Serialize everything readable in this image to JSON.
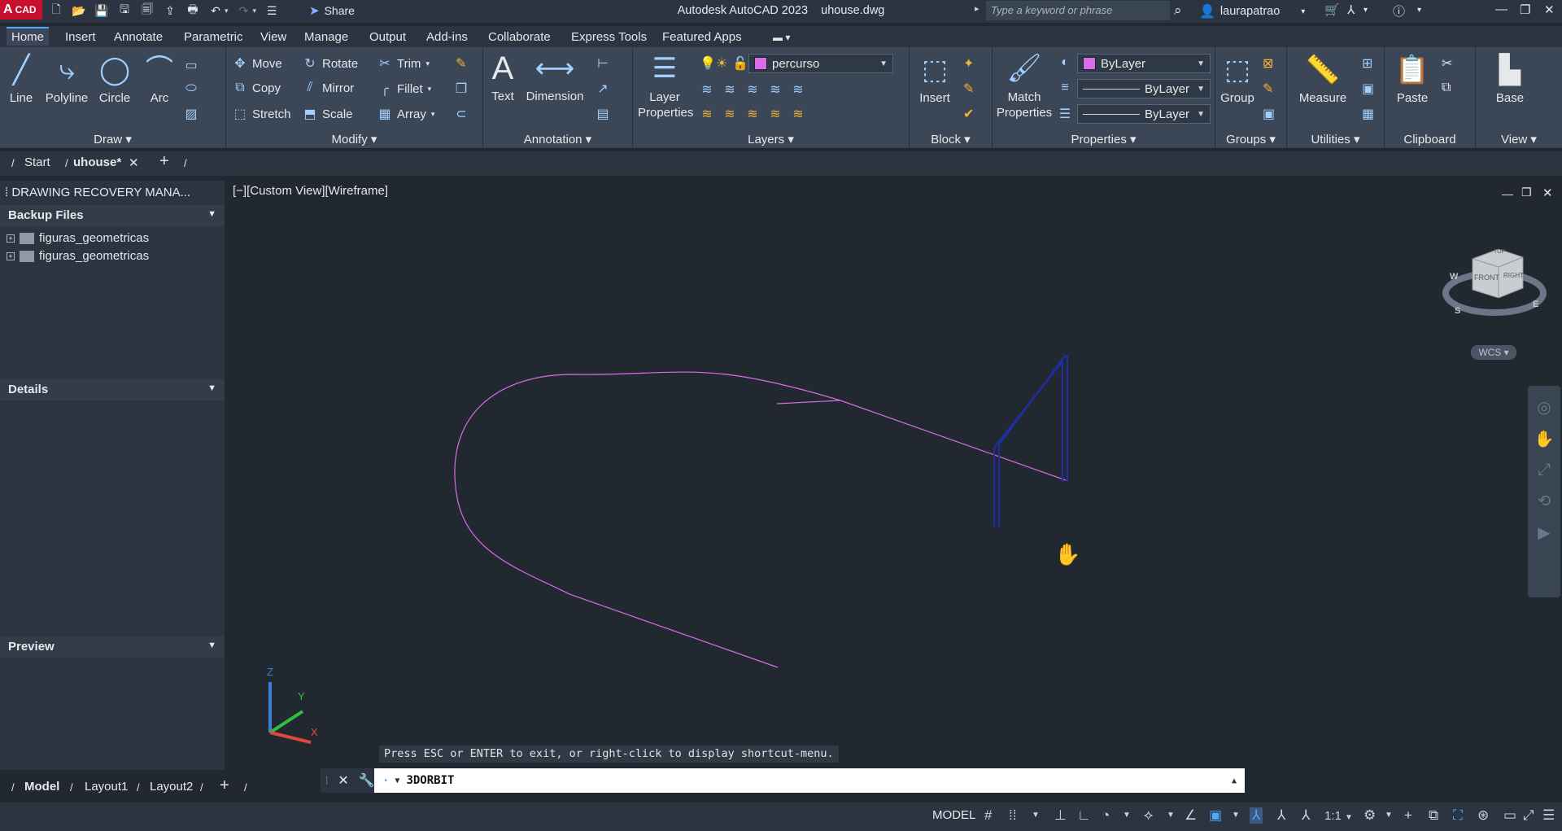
{
  "app": {
    "logo_small": "A",
    "logo_text": "CAD",
    "title": "Autodesk AutoCAD 2023",
    "file": "uhouse.dwg",
    "share_label": "Share",
    "search_placeholder": "Type a keyword or phrase",
    "user": "laurapatrao"
  },
  "ribbon_tabs": [
    "Home",
    "Insert",
    "Annotate",
    "Parametric",
    "View",
    "Manage",
    "Output",
    "Add-ins",
    "Collaborate",
    "Express Tools",
    "Featured Apps"
  ],
  "ribbon": {
    "draw": {
      "title": "Draw",
      "line": "Line",
      "polyline": "Polyline",
      "circle": "Circle",
      "arc": "Arc"
    },
    "modify": {
      "title": "Modify",
      "move": "Move",
      "rotate": "Rotate",
      "trim": "Trim",
      "copy": "Copy",
      "mirror": "Mirror",
      "fillet": "Fillet",
      "stretch": "Stretch",
      "scale": "Scale",
      "array": "Array"
    },
    "annotation": {
      "title": "Annotation",
      "text": "Text",
      "dimension": "Dimension"
    },
    "layers": {
      "title": "Layers",
      "layer_properties_1": "Layer",
      "layer_properties_2": "Properties",
      "current_layer": "percurso"
    },
    "block": {
      "title": "Block",
      "insert": "Insert"
    },
    "properties": {
      "title": "Properties",
      "match_1": "Match",
      "match_2": "Properties",
      "color": "ByLayer",
      "linetype": "ByLayer",
      "lineweight": "ByLayer"
    },
    "groups": {
      "title": "Groups",
      "group": "Group"
    },
    "utilities": {
      "title": "Utilities",
      "measure": "Measure"
    },
    "clipboard": {
      "title": "Clipboard",
      "paste": "Paste"
    },
    "view": {
      "title": "View",
      "base": "Base"
    }
  },
  "file_tabs": {
    "start": "Start",
    "current": "uhouse*"
  },
  "palette": {
    "title": "DRAWING RECOVERY MANA...",
    "backup_header": "Backup Files",
    "backup_items": [
      "figuras_geometricas",
      "figuras_geometricas"
    ],
    "details_header": "Details",
    "preview_header": "Preview"
  },
  "viewport": {
    "label": "[−][Custom View][Wireframe]",
    "viewcube_top": "TOP",
    "viewcube_front": "FRONT",
    "viewcube_right": "RIGHT",
    "compass_w": "W",
    "compass_s": "S",
    "compass_e": "E",
    "wcs": "WCS",
    "ucs_z": "Z",
    "ucs_y": "Y",
    "ucs_x": "X"
  },
  "command": {
    "prompt": "Press ESC or ENTER to exit, or right-click to display shortcut-menu.",
    "current": "3DORBIT"
  },
  "layout_tabs": [
    "Model",
    "Layout1",
    "Layout2"
  ],
  "status": {
    "model": "MODEL",
    "scale": "1:1"
  },
  "colors": {
    "accent": "#4ea7ff",
    "path": "#d66ee8",
    "frame": "#1f2ea8",
    "background": "#212830"
  }
}
